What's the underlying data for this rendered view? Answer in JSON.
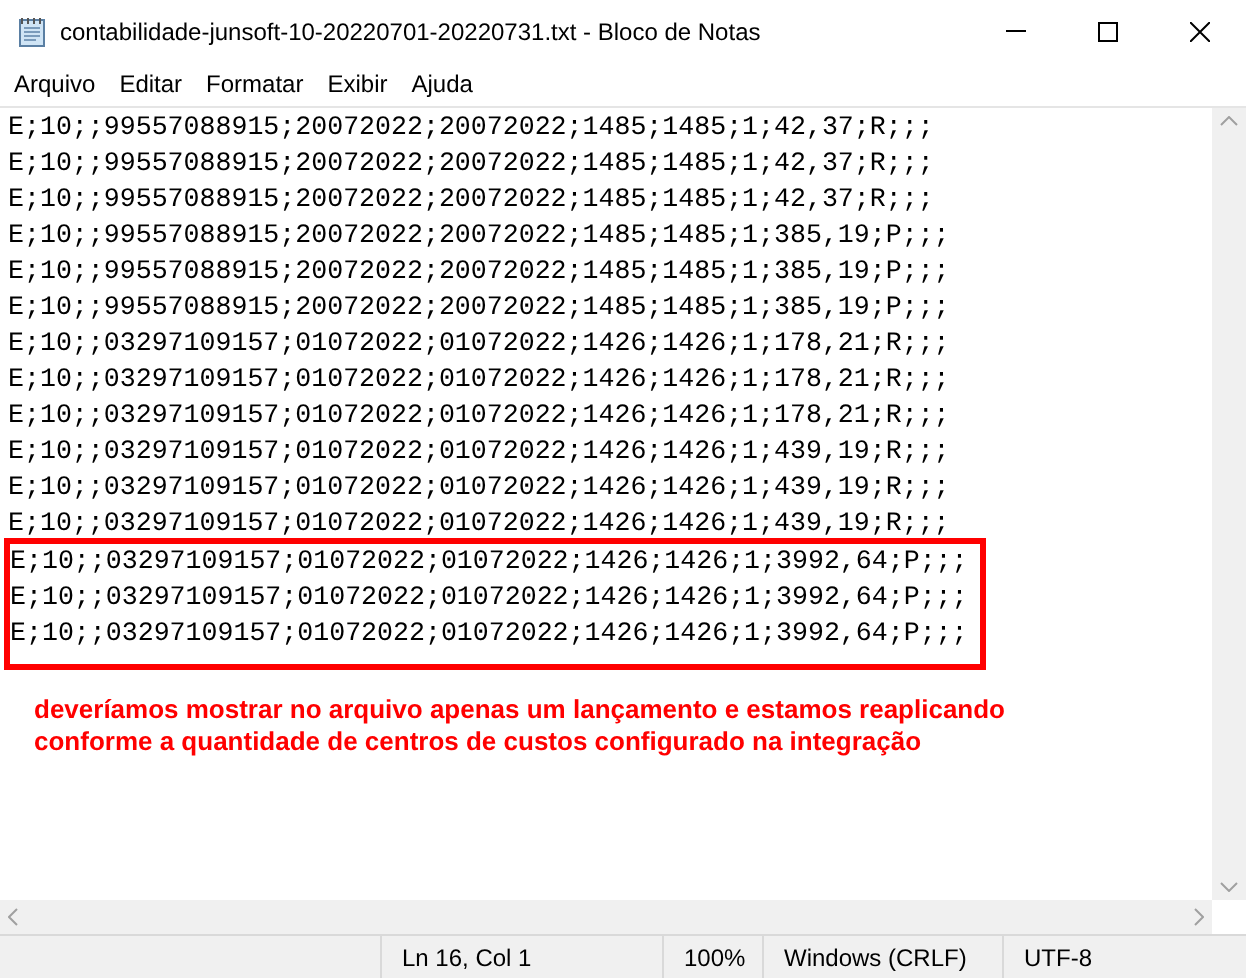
{
  "window": {
    "title": "contabilidade-junsoft-10-20220701-20220731.txt - Bloco de Notas"
  },
  "menu": [
    "Arquivo",
    "Editar",
    "Formatar",
    "Exibir",
    "Ajuda"
  ],
  "lines": [
    {
      "text": "E;10;;99557088915;20072022;20072022;1485;1485;1;42,37;R;;;",
      "highlighted": false
    },
    {
      "text": "E;10;;99557088915;20072022;20072022;1485;1485;1;42,37;R;;;",
      "highlighted": false
    },
    {
      "text": "E;10;;99557088915;20072022;20072022;1485;1485;1;42,37;R;;;",
      "highlighted": false
    },
    {
      "text": "E;10;;99557088915;20072022;20072022;1485;1485;1;385,19;P;;;",
      "highlighted": false
    },
    {
      "text": "E;10;;99557088915;20072022;20072022;1485;1485;1;385,19;P;;;",
      "highlighted": false
    },
    {
      "text": "E;10;;99557088915;20072022;20072022;1485;1485;1;385,19;P;;;",
      "highlighted": false
    },
    {
      "text": "E;10;;03297109157;01072022;01072022;1426;1426;1;178,21;R;;;",
      "highlighted": false
    },
    {
      "text": "E;10;;03297109157;01072022;01072022;1426;1426;1;178,21;R;;;",
      "highlighted": false
    },
    {
      "text": "E;10;;03297109157;01072022;01072022;1426;1426;1;178,21;R;;;",
      "highlighted": false
    },
    {
      "text": "E;10;;03297109157;01072022;01072022;1426;1426;1;439,19;R;;;",
      "highlighted": false
    },
    {
      "text": "E;10;;03297109157;01072022;01072022;1426;1426;1;439,19;R;;;",
      "highlighted": false
    },
    {
      "text": "E;10;;03297109157;01072022;01072022;1426;1426;1;439,19;R;;;",
      "highlighted": false
    },
    {
      "text": "E;10;;03297109157;01072022;01072022;1426;1426;1;3992,64;P;;;",
      "highlighted": true
    },
    {
      "text": "E;10;;03297109157;01072022;01072022;1426;1426;1;3992,64;P;;;",
      "highlighted": true
    },
    {
      "text": "E;10;;03297109157;01072022;01072022;1426;1426;1;3992,64;P;;;",
      "highlighted": true
    }
  ],
  "annotation": {
    "note": "deveríamos mostrar no arquivo apenas um lançamento e estamos reaplicando conforme a quantidade de centros de custos configurado na integração"
  },
  "status_bar": [
    "Ln 16, Col 1",
    "100%",
    "Windows (CRLF)",
    "UTF-8"
  ]
}
